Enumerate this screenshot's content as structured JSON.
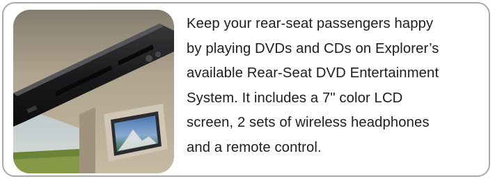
{
  "feature_card": {
    "image_alt": "Overhead console with rear-seat DVD screen",
    "description_lines": [
      "Keep your rear-seat passengers happy",
      "by playing DVDs and CDs on Explorer’s",
      "available Rear-Seat DVD Entertainment",
      "System. It includes a 7\" color LCD",
      "screen, 2 sets of wireless headphones",
      "and a remote control."
    ]
  }
}
